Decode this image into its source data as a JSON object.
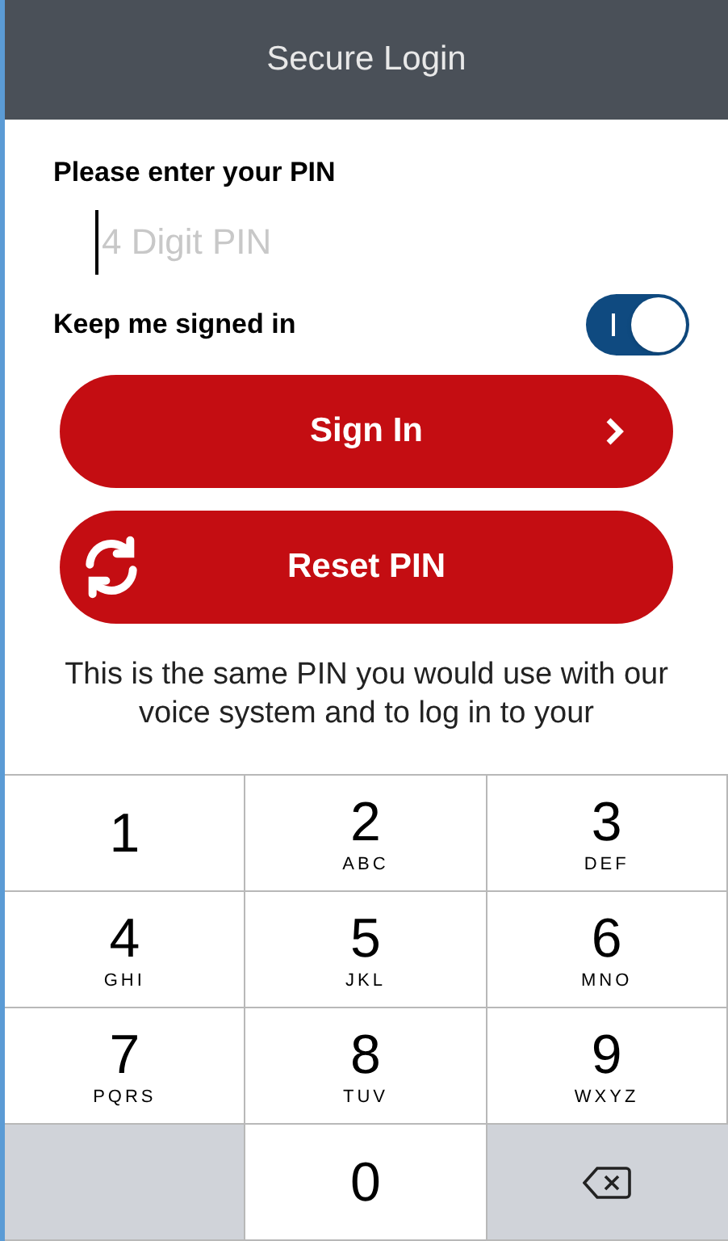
{
  "header": {
    "title": "Secure Login"
  },
  "pin": {
    "label": "Please enter your PIN",
    "placeholder": "4 Digit PIN"
  },
  "keep_signed_in": {
    "label": "Keep me signed in",
    "on": true
  },
  "buttons": [
    {
      "label": "Sign In",
      "kind": "next"
    },
    {
      "label": "Reset PIN",
      "kind": "reset"
    }
  ],
  "note": "This is the same PIN you would use with our voice system and to log in to your",
  "keypad": [
    {
      "kind": "digit",
      "digit": "1"
    },
    {
      "kind": "digit",
      "digit": "2",
      "letters": "ABC"
    },
    {
      "kind": "digit",
      "digit": "3",
      "letters": "DEF"
    },
    {
      "kind": "digit",
      "digit": "4",
      "letters": "GHI"
    },
    {
      "kind": "digit",
      "digit": "5",
      "letters": "JKL"
    },
    {
      "kind": "digit",
      "digit": "6",
      "letters": "MNO"
    },
    {
      "kind": "digit",
      "digit": "7",
      "letters": "PQRS"
    },
    {
      "kind": "digit",
      "digit": "8",
      "letters": "TUV"
    },
    {
      "kind": "digit",
      "digit": "9",
      "letters": "WXYZ"
    },
    {
      "kind": "blank"
    },
    {
      "kind": "digit",
      "digit": "0"
    },
    {
      "kind": "delete"
    }
  ]
}
